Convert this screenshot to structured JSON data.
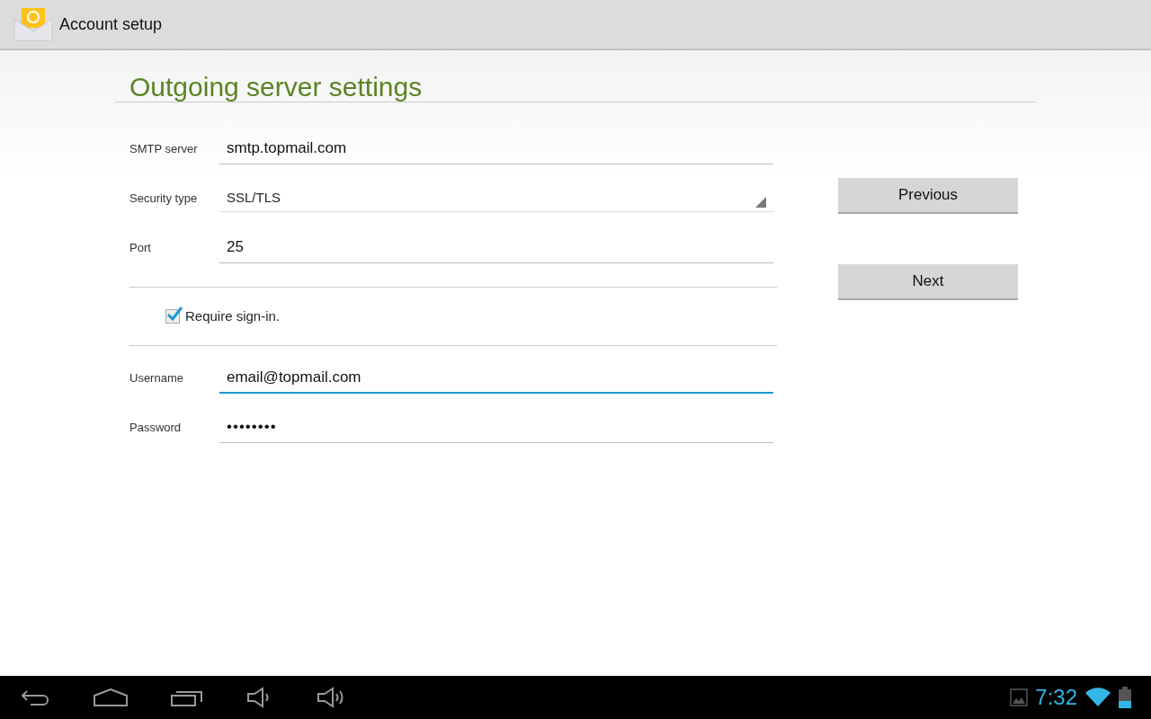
{
  "action_bar": {
    "title": "Account setup"
  },
  "heading": "Outgoing server settings",
  "server_fields": [
    {
      "kind": "text",
      "label": "SMTP server",
      "value": "smtp.topmail.com",
      "focused": false
    },
    {
      "kind": "select",
      "label": "Security type",
      "value": "SSL/TLS",
      "focused": false
    },
    {
      "kind": "text",
      "label": "Port",
      "value": "25",
      "focused": false
    }
  ],
  "require_signin": {
    "label": "Require sign-in.",
    "checked": true
  },
  "signin_fields": [
    {
      "kind": "text",
      "label": "Username",
      "value": "email@topmail.com",
      "focused": true
    },
    {
      "kind": "password",
      "label": "Password",
      "value": "••••••••",
      "focused": false
    }
  ],
  "buttons": [
    "Previous",
    "Next"
  ],
  "status_bar": {
    "time": "7:32"
  }
}
